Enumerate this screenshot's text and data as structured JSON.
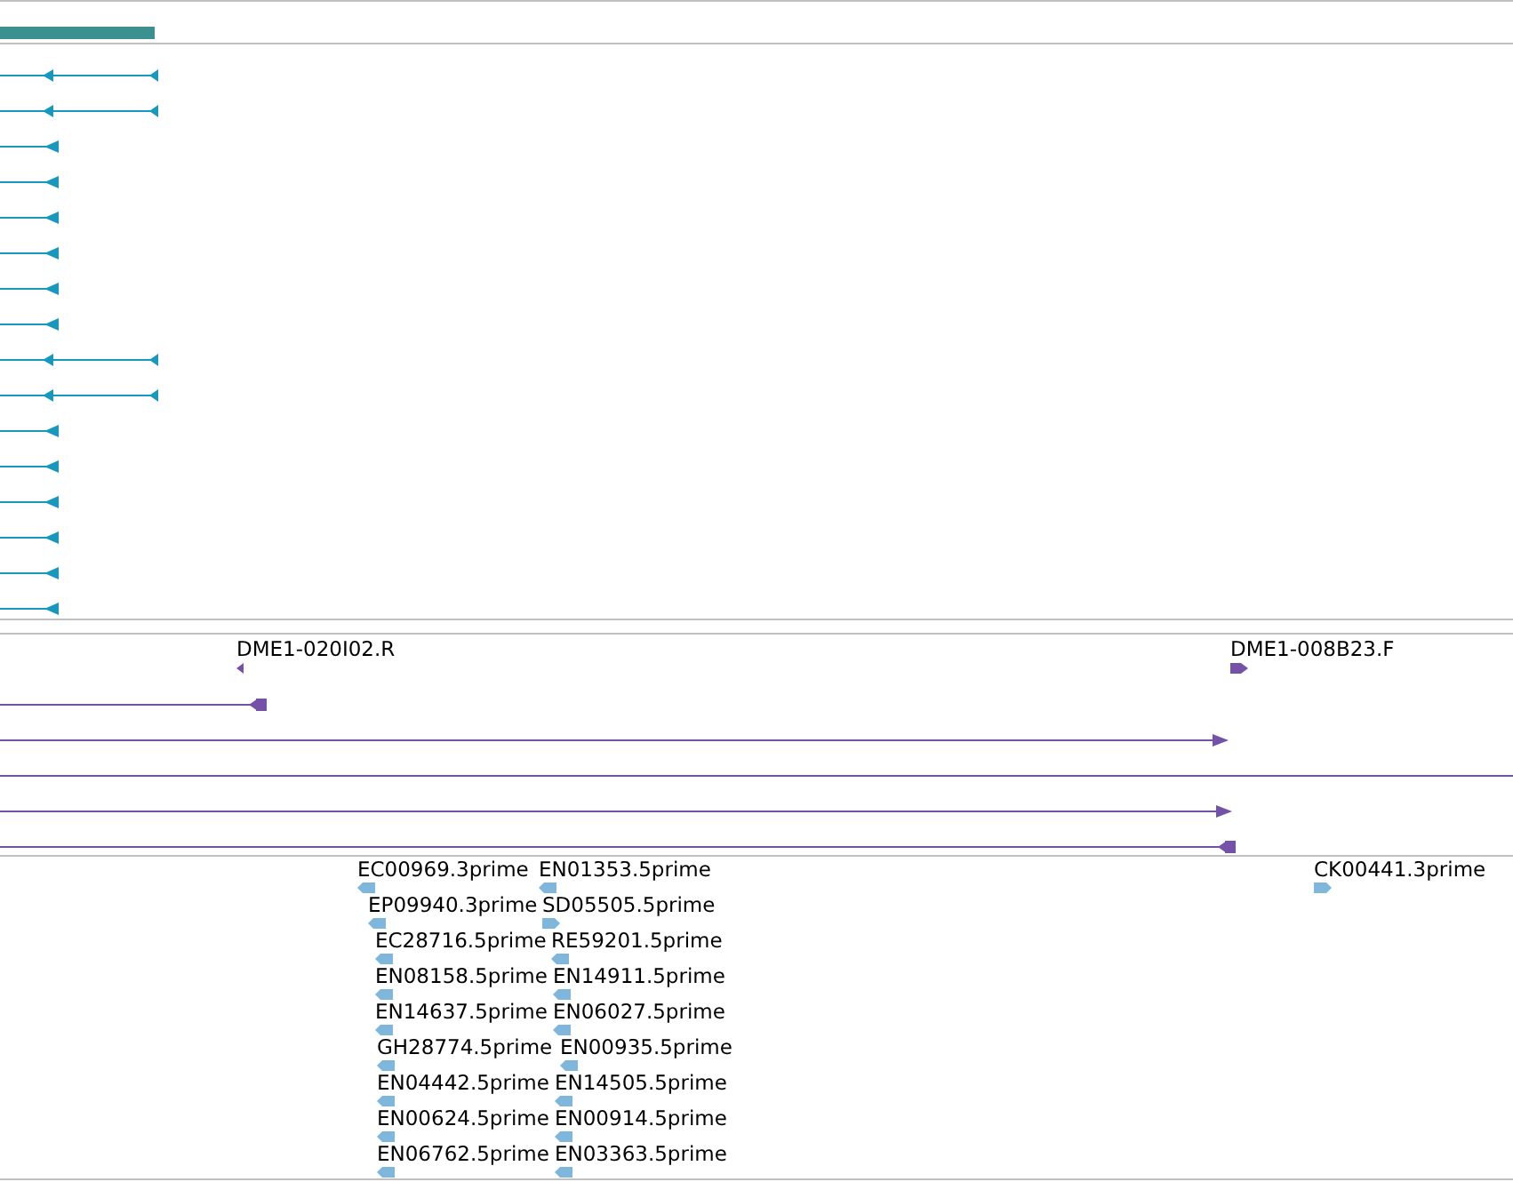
{
  "track_1": {
    "features": [
      {
        "reverse": true
      },
      {
        "reverse": true
      },
      {
        "reverse": true
      },
      {
        "reverse": true
      },
      {
        "reverse": true
      },
      {
        "reverse": true
      },
      {
        "reverse": true
      },
      {
        "reverse": true
      },
      {
        "reverse": true
      },
      {
        "reverse": true
      },
      {
        "reverse": true
      },
      {
        "reverse": true
      },
      {
        "reverse": true
      },
      {
        "reverse": true
      },
      {
        "reverse": true
      },
      {
        "reverse": true
      }
    ]
  },
  "track_2": {
    "features": [
      {
        "kind": "tagged",
        "label": "DME1-020I02.R",
        "reverse": true
      },
      {
        "kind": "tagged",
        "label": "DME1-008B23.F",
        "reverse": false
      },
      {
        "kind": "arrow",
        "reverse": true
      },
      {
        "kind": "arrow",
        "reverse": false
      },
      {
        "kind": "line"
      },
      {
        "kind": "arrow",
        "reverse": false
      },
      {
        "kind": "arrow",
        "reverse": true
      }
    ]
  },
  "track_3": {
    "features": [
      {
        "label": "EC00969.3prime",
        "reverse": true
      },
      {
        "label": "EN01353.5prime",
        "reverse": true
      },
      {
        "label": "CK00441.3prime",
        "reverse": false
      },
      {
        "label": "EP09940.3prime",
        "reverse": true
      },
      {
        "label": "SD05505.5prime",
        "reverse": false
      },
      {
        "label": "EC28716.5prime",
        "reverse": true
      },
      {
        "label": "RE59201.5prime",
        "reverse": true
      },
      {
        "label": "EN08158.5prime",
        "reverse": true
      },
      {
        "label": "EN14911.5prime",
        "reverse": true
      },
      {
        "label": "EN14637.5prime",
        "reverse": true
      },
      {
        "label": "EN06027.5prime",
        "reverse": true
      },
      {
        "label": "GH28774.5prime",
        "reverse": true
      },
      {
        "label": "EN00935.5prime",
        "reverse": true
      },
      {
        "label": "EN04442.5prime",
        "reverse": true
      },
      {
        "label": "EN14505.5prime",
        "reverse": true
      },
      {
        "label": "EN00624.5prime",
        "reverse": true
      },
      {
        "label": "EN00914.5prime",
        "reverse": true
      },
      {
        "label": "EN06762.5prime",
        "reverse": true
      },
      {
        "label": "EN03363.5prime",
        "reverse": true
      }
    ]
  }
}
